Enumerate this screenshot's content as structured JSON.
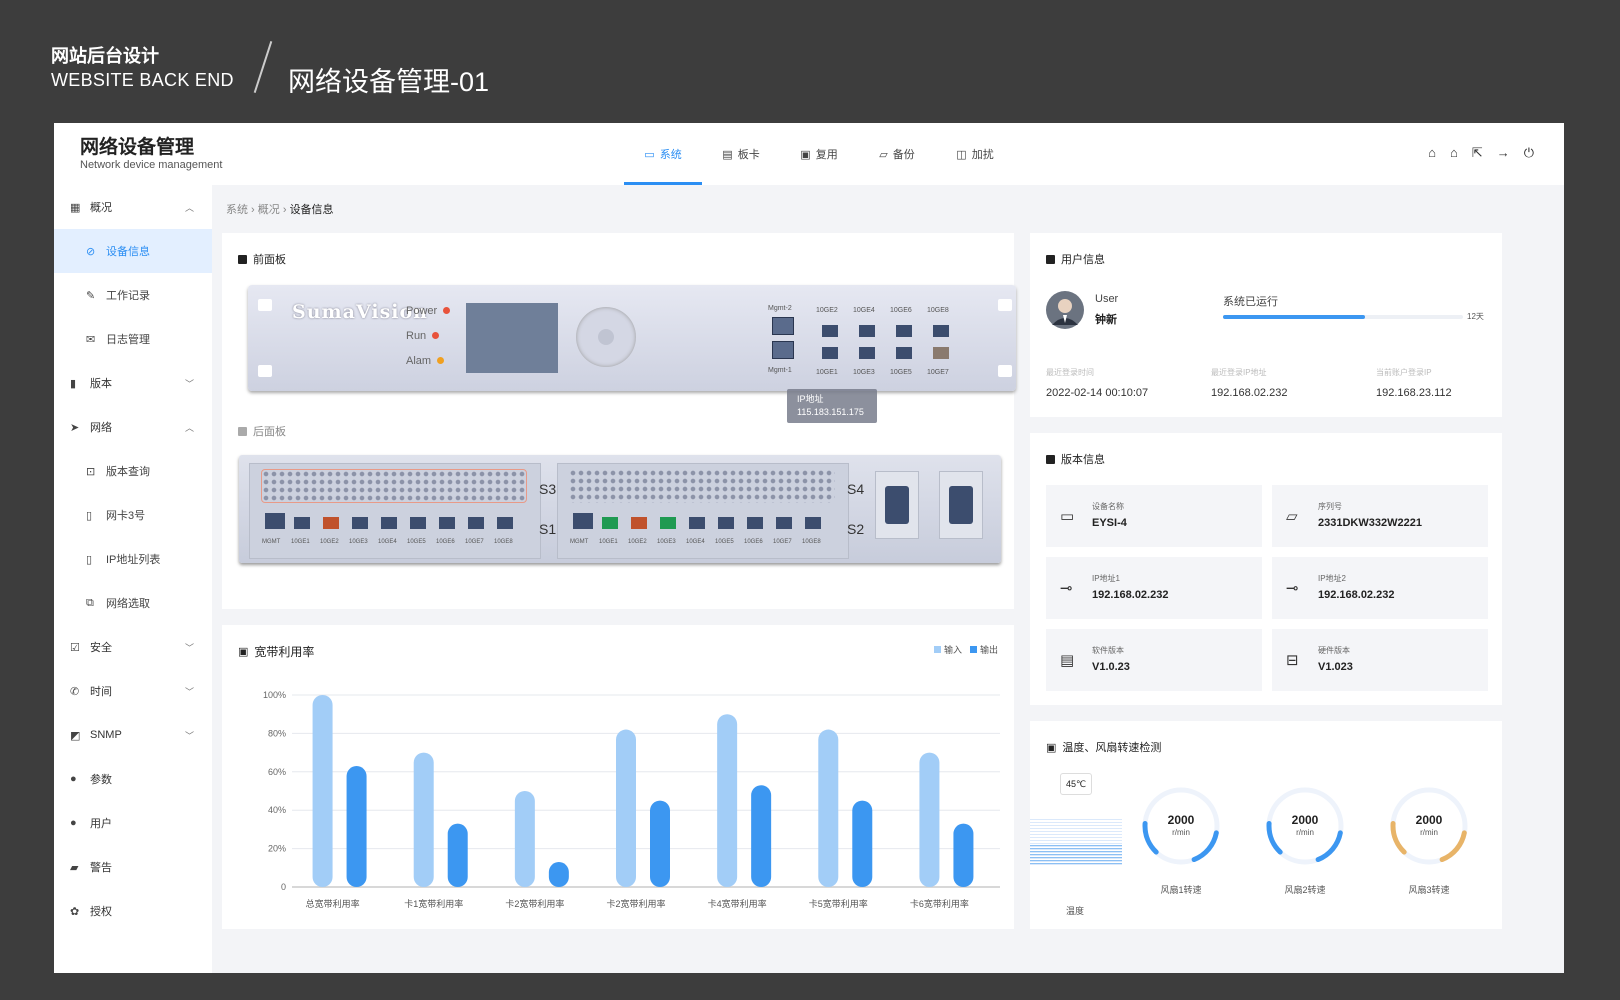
{
  "deco": {
    "title_cn": "网站后台设计",
    "title_en": "WEBSITE BACK END",
    "page_title": "网络设备管理-01"
  },
  "app": {
    "brand": "网络设备管理",
    "brand_sub": "Network device management"
  },
  "tabs": [
    {
      "label": "系统",
      "icon": "monitor-icon",
      "active": true
    },
    {
      "label": "板卡",
      "icon": "card-icon"
    },
    {
      "label": "复用",
      "icon": "reuse-icon"
    },
    {
      "label": "备份",
      "icon": "folder-icon"
    },
    {
      "label": "加扰",
      "icon": "scramble-icon"
    }
  ],
  "top_icons": [
    "home-icon",
    "bell-icon",
    "export-icon",
    "arrow-icon",
    "power-icon"
  ],
  "sidebar": {
    "items": [
      {
        "label": "概况",
        "icon": "grid-icon",
        "expanded": true
      },
      {
        "label": "设备信息",
        "icon": "paperclip-icon",
        "sub": true,
        "selected": true
      },
      {
        "label": "工作记录",
        "icon": "pen-icon",
        "sub": true
      },
      {
        "label": "日志管理",
        "icon": "mail-icon",
        "sub": true
      },
      {
        "label": "版本",
        "icon": "bars-icon",
        "expanded": false
      },
      {
        "label": "网络",
        "icon": "send-icon",
        "expanded": true
      },
      {
        "label": "版本查询",
        "icon": "lock-icon",
        "sub": true
      },
      {
        "label": "网卡3号",
        "icon": "doc-icon",
        "sub": true
      },
      {
        "label": "IP地址列表",
        "icon": "doc-icon",
        "sub": true
      },
      {
        "label": "网络选取",
        "icon": "copy-icon",
        "sub": true
      },
      {
        "label": "安全",
        "icon": "check-icon",
        "expanded": false
      },
      {
        "label": "时间",
        "icon": "phone-icon",
        "expanded": false
      },
      {
        "label": "SNMP",
        "icon": "chart-icon",
        "expanded": false
      },
      {
        "label": "参数",
        "icon": "user-icon"
      },
      {
        "label": "用户",
        "icon": "user-icon"
      },
      {
        "label": "警告",
        "icon": "clipboard-icon"
      },
      {
        "label": "授权",
        "icon": "gear-icon"
      }
    ]
  },
  "breadcrumb": {
    "items": [
      "系统",
      "概况"
    ],
    "current": "设备信息"
  },
  "front_panel": {
    "title": "前面板",
    "logo": "SumaVision",
    "leds": [
      {
        "label": "Power",
        "color": "#e8533c"
      },
      {
        "label": "Run",
        "color": "#e8533c"
      },
      {
        "label": "Alam",
        "color": "#f0a020"
      }
    ],
    "mgmt_top": "Mgmt-2",
    "mgmt_bottom": "Mgmt-1",
    "port_top": [
      "10GE2",
      "10GE4",
      "10GE6",
      "10GE8"
    ],
    "port_bottom": [
      "10GE1",
      "10GE3",
      "10GE5",
      "10GE7"
    ],
    "tooltip_label": "IP地址",
    "tooltip_value": "115.183.151.175"
  },
  "back_panel": {
    "title": "后面板",
    "slots": [
      "S3",
      "S4",
      "S1",
      "S2"
    ],
    "port_labels": [
      "MGMT",
      "10GE1",
      "10GE2",
      "10GE3",
      "10GE4",
      "10GE5",
      "10GE6",
      "10GE7",
      "10GE8"
    ],
    "left_port_colors": [
      "#3c4d6e",
      "#3c4d6e",
      "#c0522c",
      "#3c4d6e",
      "#3c4d6e",
      "#3c4d6e",
      "#3c4d6e",
      "#3c4d6e",
      "#3c4d6e"
    ],
    "right_port_colors": [
      "#3c4d6e",
      "#1f9a52",
      "#c0522c",
      "#1f9a52",
      "#3c4d6e",
      "#3c4d6e",
      "#3c4d6e",
      "#3c4d6e",
      "#3c4d6e"
    ]
  },
  "bandwidth": {
    "title": "宽带利用率",
    "legend_in": "输入",
    "legend_out": "输出"
  },
  "chart_data": {
    "type": "bar",
    "categories": [
      "总宽带利用率",
      "卡1宽带利用率",
      "卡2宽带利用率",
      "卡2宽带利用率",
      "卡4宽带利用率",
      "卡5宽带利用率",
      "卡6宽带利用率"
    ],
    "series": [
      {
        "name": "输入",
        "values": [
          100,
          70,
          50,
          82,
          90,
          82,
          70
        ],
        "color": "#a2cdf7"
      },
      {
        "name": "输出",
        "values": [
          63,
          33,
          13,
          45,
          53,
          45,
          33
        ],
        "color": "#3c97f1"
      }
    ],
    "yticks": [
      "100%",
      "80%",
      "60%",
      "40%",
      "20%",
      "0"
    ],
    "ylim": [
      0,
      100
    ],
    "grid": true,
    "legend": "top-right"
  },
  "user": {
    "title": "用户信息",
    "role": "User",
    "name": "钟新",
    "run_label": "系统已运行",
    "run_days": "12天",
    "run_progress": 0.59,
    "fields": [
      {
        "label": "最近登录时间",
        "value": "2022-02-14 00:10:07"
      },
      {
        "label": "最近登录IP地址",
        "value": "192.168.02.232"
      },
      {
        "label": "当前账户登录IP",
        "value": "192.168.23.112"
      }
    ]
  },
  "version": {
    "title": "版本信息",
    "tiles": [
      {
        "label": "设备名称",
        "value": "EYSI-4",
        "icon": "monitor-icon"
      },
      {
        "label": "序列号",
        "value": "2331DKW332W2221",
        "icon": "folder-icon"
      },
      {
        "label": "IP地址1",
        "value": "192.168.02.232",
        "icon": "link-icon"
      },
      {
        "label": "IP地址2",
        "value": "192.168.02.232",
        "icon": "link-icon"
      },
      {
        "label": "软件版本",
        "value": "V1.0.23",
        "icon": "stack-icon"
      },
      {
        "label": "硬件版本",
        "value": "V1.023",
        "icon": "inbox-icon"
      }
    ]
  },
  "temp": {
    "title": "温度、风扇转速检测",
    "temp_value": "45℃",
    "temp_label": "温度",
    "fans": [
      {
        "label": "风扇1转速",
        "value": "2000",
        "unit": "r/min",
        "color": "#3c97f1",
        "level": 0.3
      },
      {
        "label": "风扇2转速",
        "value": "2000",
        "unit": "r/min",
        "color": "#3c97f1",
        "level": 0.3
      },
      {
        "label": "风扇3转速",
        "value": "2000",
        "unit": "r/min",
        "color": "#e8b468",
        "level": 0.3
      }
    ]
  }
}
